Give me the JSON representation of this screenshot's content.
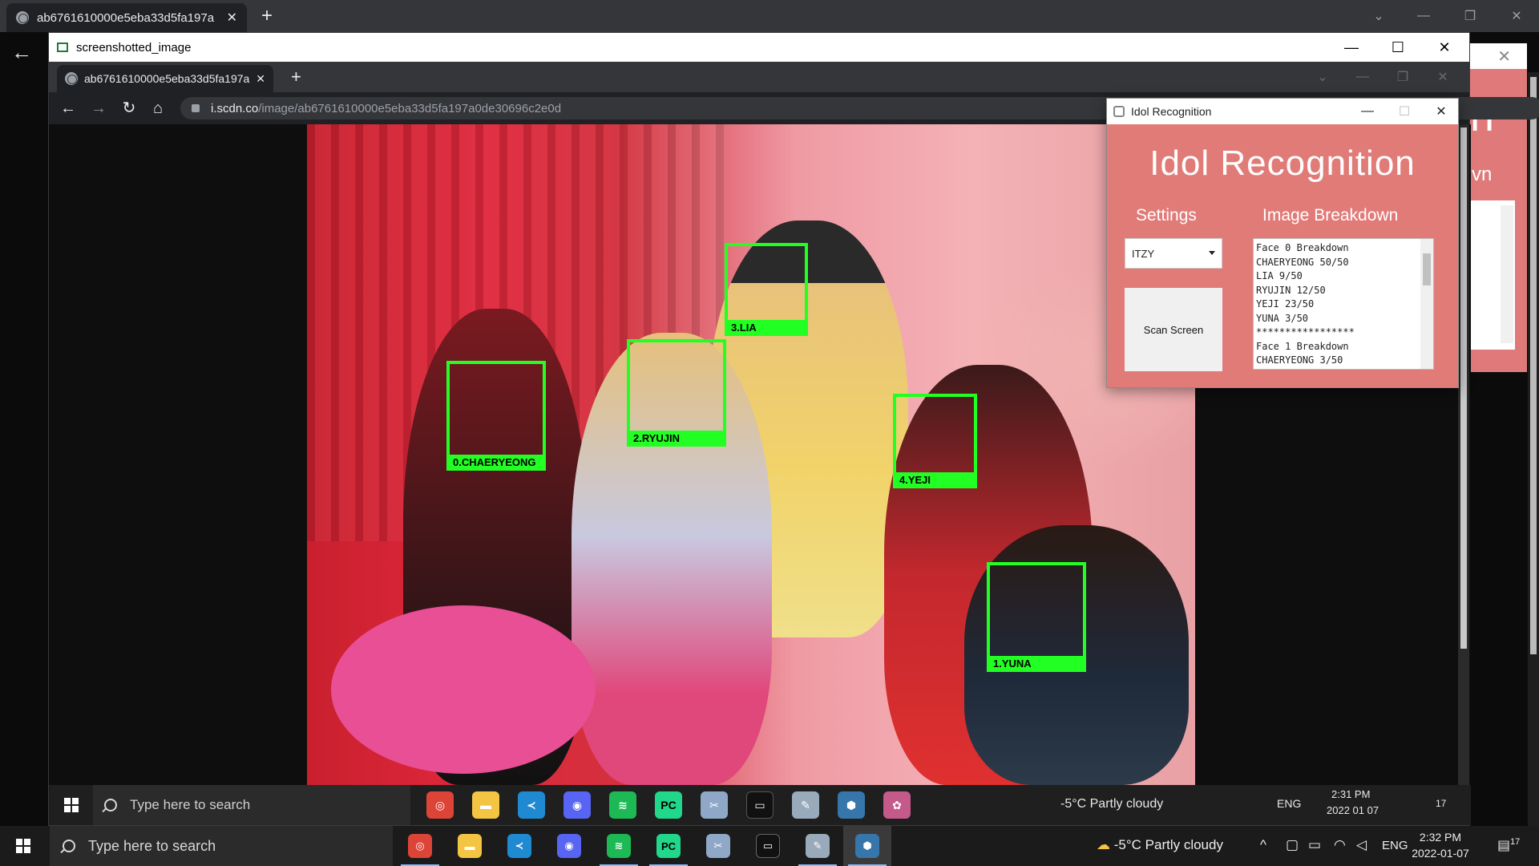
{
  "outer_browser": {
    "tab_title": "ab6761610000e5eba33d5fa197a",
    "new_tab": "+",
    "close": "✕",
    "back": "←",
    "controls": {
      "chevron": "⌄",
      "minimize": "—",
      "restore": "❐",
      "close": "✕"
    }
  },
  "ss_window": {
    "title": "screenshotted_image",
    "controls": {
      "minimize": "—",
      "maximize": "☐",
      "close": "✕"
    }
  },
  "inner_browser": {
    "tab_title": "ab6761610000e5eba33d5fa197a",
    "new_tab": "+",
    "close": "✕",
    "nav": {
      "back": "←",
      "forward": "→",
      "reload": "↻",
      "home": "⌂"
    },
    "url_host": "i.scdn.co",
    "url_path": "/image/ab6761610000e5eba33d5fa197a0de30696c2e0d",
    "controls": {
      "chevron": "⌄",
      "minimize": "—",
      "restore": "❐",
      "close": "✕"
    }
  },
  "faces": [
    {
      "label": "0.CHAERYEONG"
    },
    {
      "label": "2.RYUJIN"
    },
    {
      "label": "3.LIA"
    },
    {
      "label": "4.YEJI"
    },
    {
      "label": "1.YUNA"
    }
  ],
  "idol_window": {
    "title": "Idol Recognition",
    "heading": "Idol Recognition",
    "settings_label": "Settings",
    "breakdown_label": "Image Breakdown",
    "group_selected": "ITZY",
    "scan_button": "Scan Screen",
    "controls": {
      "minimize": "—",
      "maximize": "☐",
      "close": "✕"
    },
    "breakdown_lines": [
      "Face 0 Breakdown",
      "CHAERYEONG 50/50",
      "LIA 9/50",
      "RYUJIN 12/50",
      "YEJI 23/50",
      "YUNA 3/50",
      "*****************",
      "Face 1 Breakdown",
      "CHAERYEONG 3/50"
    ]
  },
  "behind_window": {
    "big": "n",
    "sub": "vn",
    "close": "✕"
  },
  "inner_taskbar": {
    "search_placeholder": "Type here to search",
    "weather": "-5°C  Partly cloudy",
    "lang": "ENG",
    "time": "2:31 PM",
    "date": "2022 01 07",
    "notifications": "17"
  },
  "taskbar": {
    "search_placeholder": "Type here to search",
    "weather": "-5°C  Partly cloudy",
    "lang": "ENG",
    "time": "2:32 PM",
    "date": "2022-01-07",
    "notifications": "17",
    "apps": [
      {
        "name": "chrome",
        "glyph": "◎",
        "color": "#db4437"
      },
      {
        "name": "file-explorer",
        "glyph": "▬",
        "color": "#f4c542"
      },
      {
        "name": "vscode",
        "glyph": "≺",
        "color": "#1f8ad2"
      },
      {
        "name": "discord",
        "glyph": "◉",
        "color": "#5865f2"
      },
      {
        "name": "spotify",
        "glyph": "≋",
        "color": "#1db954"
      },
      {
        "name": "pycharm",
        "glyph": "PC",
        "color": "#21d789"
      },
      {
        "name": "snipping",
        "glyph": "✂",
        "color": "#8fa8c8"
      },
      {
        "name": "terminal",
        "glyph": "▭",
        "color": "#111111"
      },
      {
        "name": "paint",
        "glyph": "✎",
        "color": "#9ab"
      },
      {
        "name": "python",
        "glyph": "⬢",
        "color": "#3776ab"
      }
    ]
  }
}
